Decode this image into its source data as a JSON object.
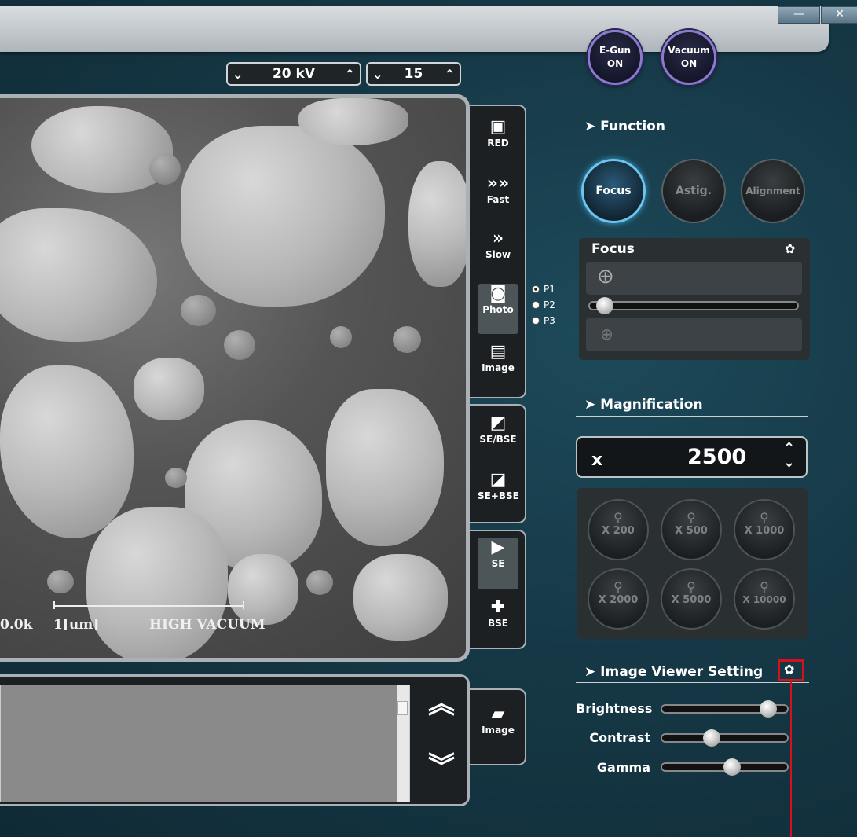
{
  "window": {
    "minimize": "—",
    "close": "✕"
  },
  "kv_stepper": {
    "down": "⌄",
    "value": "20 kV",
    "up": "⌃"
  },
  "spot_stepper": {
    "down": "⌄",
    "value": "15",
    "up": "⌃"
  },
  "egun": {
    "title": "E-Gun",
    "state": "ON"
  },
  "vacuum": {
    "title": "Vacuum",
    "state": "ON"
  },
  "viewer": {
    "hv": "0.0k",
    "scale": "1[um]",
    "mode": "HIGH VACUUM"
  },
  "scan_tools": [
    {
      "label": "RED",
      "icon": "monitor-icon"
    },
    {
      "label": "Fast",
      "icon": "fast-arrows-icon"
    },
    {
      "label": "Slow",
      "icon": "slow-arrows-icon"
    },
    {
      "label": "Photo",
      "icon": "camera-icon"
    },
    {
      "label": "Image",
      "icon": "image-stack-icon"
    }
  ],
  "photo_presets": [
    "P1",
    "P2",
    "P3"
  ],
  "detector_tools": [
    {
      "label": "SE/BSE",
      "icon": "se-bse-icon"
    },
    {
      "label": "SE+BSE",
      "icon": "se-plus-bse-icon"
    }
  ],
  "signal_tools": [
    {
      "label": "SE",
      "icon": "se-detector-icon"
    },
    {
      "label": "BSE",
      "icon": "bse-detector-icon"
    }
  ],
  "image_button": {
    "label": "Image"
  },
  "function": {
    "title": "Function",
    "buttons": [
      "Focus",
      "Astig.",
      "Alignment"
    ],
    "panel_title": "Focus"
  },
  "magnification": {
    "title": "Magnification",
    "prefix": "x",
    "value": "2500",
    "presets": [
      "X 200",
      "X 500",
      "X 1000",
      "X 2000",
      "X 5000",
      "X 10000"
    ]
  },
  "image_viewer_setting": {
    "title": "Image Viewer Setting",
    "sliders": [
      {
        "label": "Brightness",
        "value": 0.88
      },
      {
        "label": "Contrast",
        "value": 0.37
      },
      {
        "label": "Gamma",
        "value": 0.55
      }
    ]
  },
  "colors": {
    "accent_blue": "#6fc4ee",
    "highlight_red": "#d8101a",
    "gun_ring": "#8a7bd0"
  }
}
